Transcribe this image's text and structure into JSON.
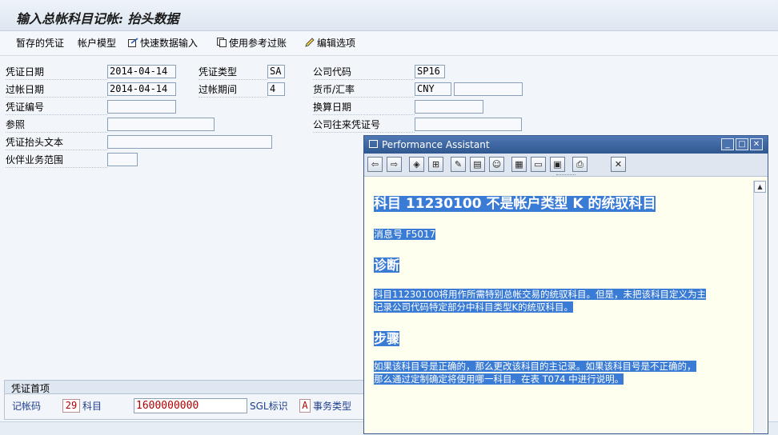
{
  "header": {
    "title": "输入总帐科目记帐: 抬头数据"
  },
  "toolbar": {
    "items": [
      {
        "label": "暂存的凭证",
        "icon": ""
      },
      {
        "label": "帐户模型",
        "icon": ""
      },
      {
        "label": "快速数据输入",
        "icon": "quick-entry-icon"
      },
      {
        "label": "使用参考过账",
        "icon": "reference-icon"
      },
      {
        "label": "编辑选项",
        "icon": "pencil-icon"
      }
    ]
  },
  "form": {
    "doc_date": {
      "label": "凭证日期",
      "value": "2014-04-14"
    },
    "doc_type": {
      "label": "凭证类型",
      "value": "SA"
    },
    "company_code": {
      "label": "公司代码",
      "value": "SP16"
    },
    "posting_date": {
      "label": "过帐日期",
      "value": "2014-04-14"
    },
    "period": {
      "label": "过帐期间",
      "value": "4"
    },
    "currency": {
      "label": "货币/汇率",
      "value": "CNY",
      "rate": ""
    },
    "doc_number": {
      "label": "凭证编号",
      "value": ""
    },
    "translation_date": {
      "label": "换算日期",
      "value": ""
    },
    "reference": {
      "label": "参照",
      "value": ""
    },
    "intercompany": {
      "label": "公司往来凭证号",
      "value": ""
    },
    "header_text": {
      "label": "凭证抬头文本",
      "value": ""
    },
    "trading_partner": {
      "label": "伙伴业务范围",
      "value": ""
    }
  },
  "first_item": {
    "section_title": "凭证首项",
    "posting_key_label": "记帐码",
    "posting_key": "29",
    "account_label": "科目",
    "account": "1600000000",
    "sgl_label": "SGL标识",
    "sgl": "A",
    "trans_type_label": "事务类型"
  },
  "assistant": {
    "window_title": "Performance Assistant",
    "heading": "科目 11230100 不是帐户类型 K 的统驭科目",
    "message_no": "消息号 F5017",
    "diagnosis_title": "诊断",
    "diagnosis_line1": "科目11230100将用作所需特别总帐交易的统驭科目。但是，未把该科目定义为主",
    "diagnosis_line2": "记录公司代码特定部分中科目类型K的统驭科目。",
    "procedure_title": "步骤",
    "procedure_line1": "如果该科目号是正确的，那么更改该科目的主记录。如果该科目号是不正确的，",
    "procedure_line2": "那么通过定制确定将使用哪一科目。在表 T074 中进行说明。"
  }
}
